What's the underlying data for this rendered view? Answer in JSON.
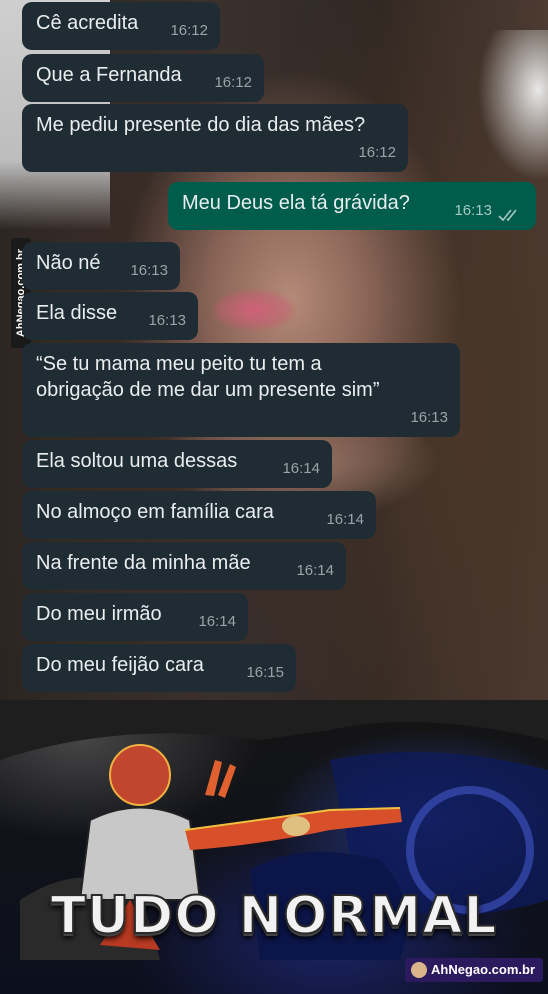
{
  "messages": [
    {
      "text": "Cê acredita",
      "time": "16:12"
    },
    {
      "text": "Que a Fernanda",
      "time": "16:12"
    },
    {
      "text": "Me pediu presente do dia das mães?",
      "time": "16:12"
    },
    {
      "text": "Meu Deus ela tá grávida?",
      "time": "16:13",
      "outgoing": true
    },
    {
      "text": "Não né",
      "time": "16:13"
    },
    {
      "text": "Ela disse",
      "time": "16:13"
    },
    {
      "text": "“Se tu mama meu peito tu tem a\nobrigação de me dar um presente sim”",
      "time": "16:13"
    },
    {
      "text": "Ela soltou uma dessas",
      "time": "16:14"
    },
    {
      "text": "No almoço em família cara",
      "time": "16:14"
    },
    {
      "text": "Na frente da minha mãe",
      "time": "16:14"
    },
    {
      "text": "Do meu irmão",
      "time": "16:14"
    },
    {
      "text": "Do meu feijão cara",
      "time": "16:15"
    }
  ],
  "watermark_side": "AhNegao.com.br",
  "watermark_bottom": "AhNegao.com.br",
  "meme": {
    "caption": "TUDO NORMAL"
  },
  "colors": {
    "incoming_bubble": "#1f2c33",
    "outgoing_bubble": "#005c4b",
    "read_ticks": "#53bdeb"
  }
}
